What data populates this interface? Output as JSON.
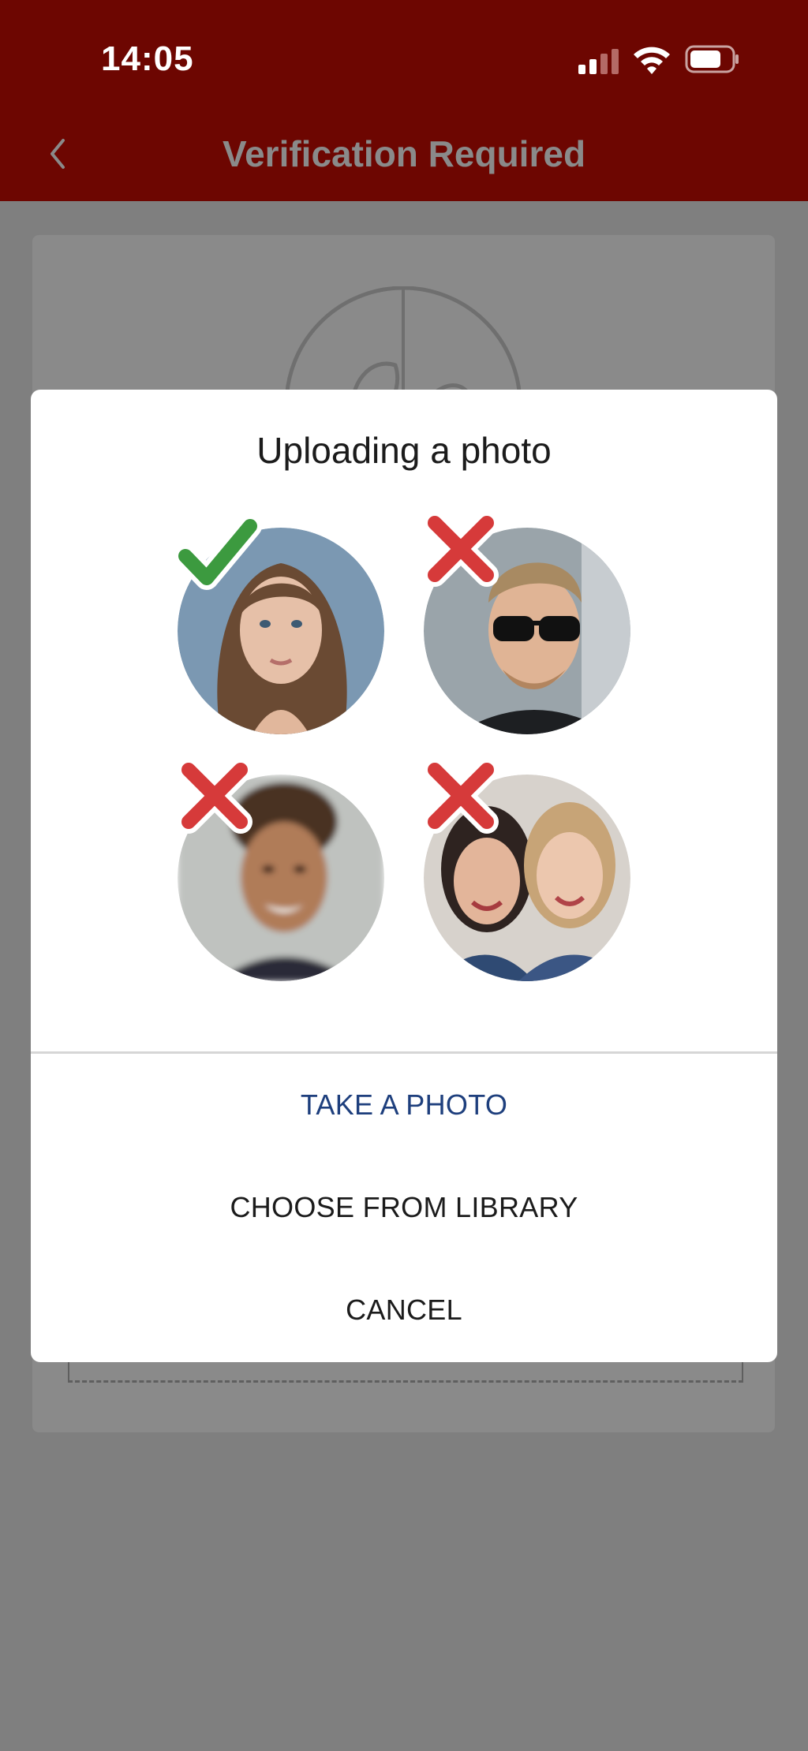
{
  "status_bar": {
    "time": "14:05"
  },
  "header": {
    "title": "Verification Required"
  },
  "modal": {
    "title": "Uploading a photo",
    "examples": [
      {
        "status": "good",
        "icon": "check-icon"
      },
      {
        "status": "bad",
        "icon": "x-icon"
      },
      {
        "status": "bad",
        "icon": "x-icon"
      },
      {
        "status": "bad",
        "icon": "x-icon"
      }
    ],
    "actions": {
      "take_photo": "TAKE A PHOTO",
      "choose_library": "CHOOSE FROM LIBRARY",
      "cancel": "CANCEL"
    }
  },
  "colors": {
    "header_bg": "#6d0601",
    "overlay_bg": "#7f7f7f",
    "good": "#3c9a3f",
    "bad": "#d63a3a",
    "primary_action": "#1e3f7d"
  }
}
